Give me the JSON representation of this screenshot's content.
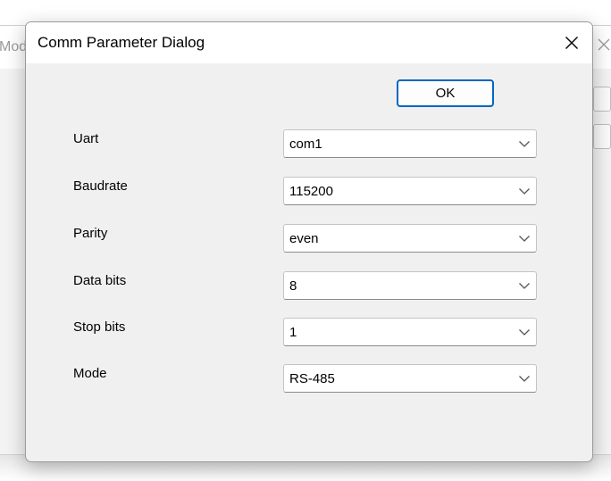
{
  "background_window": {
    "title": "Mod"
  },
  "dialog": {
    "title": "Comm Parameter Dialog",
    "ok_label": "OK",
    "fields": [
      {
        "label": "Uart",
        "value": "com1"
      },
      {
        "label": "Baudrate",
        "value": "115200"
      },
      {
        "label": "Parity",
        "value": "even"
      },
      {
        "label": "Data bits",
        "value": "8"
      },
      {
        "label": "Stop bits",
        "value": "1"
      },
      {
        "label": "Mode",
        "value": "RS-485"
      }
    ]
  },
  "icons": {
    "close": "close-icon",
    "dropdown": "chevron-down-icon"
  },
  "colors": {
    "accent": "#0067c0",
    "dialog_bg": "#f0f0f0",
    "titlebar_bg": "#ffffff"
  }
}
